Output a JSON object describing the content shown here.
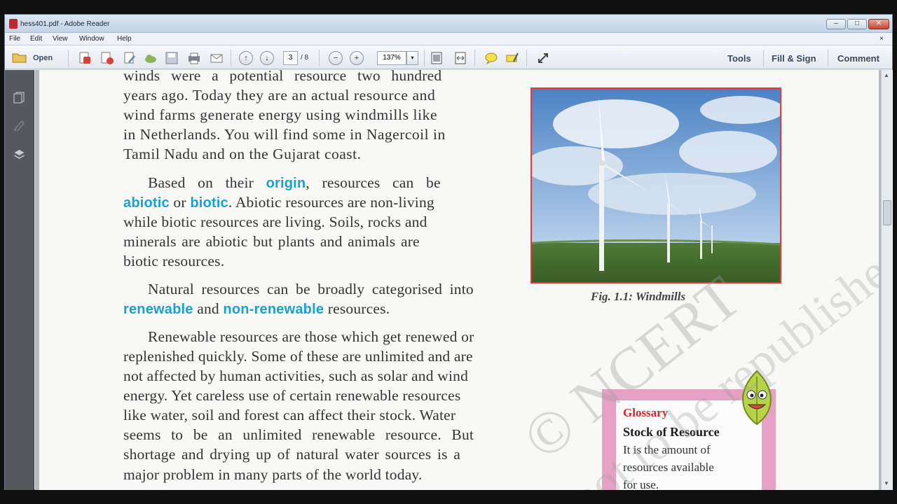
{
  "window": {
    "title": "hess401.pdf - Adobe Reader",
    "controls": {
      "minimize": "–",
      "maximize": "□",
      "close": "✕"
    }
  },
  "menu": {
    "items": [
      "File",
      "Edit",
      "View",
      "Window",
      "Help"
    ],
    "close_glyph": "×"
  },
  "toolbar": {
    "open_label": "Open",
    "page_current": "3",
    "page_total": "/ 8",
    "zoom": "137%",
    "zoom_dropdown_glyph": "▾",
    "zoom_out_glyph": "−",
    "zoom_in_glyph": "+",
    "prev_glyph": "↑",
    "next_glyph": "↓",
    "tools_label": "Tools",
    "fillsign_label": "Fill & Sign",
    "comment_label": "Comment"
  },
  "document": {
    "paragraph1": [
      "winds were a potential resource two hundred",
      "years ago. Today they are an actual resource and",
      "wind farms generate energy using windmills like",
      "in Netherlands. You will find some in Nagercoil in",
      "Tamil Nadu and on the Gujarat coast."
    ],
    "paragraph2": {
      "l1_a": "Based on their ",
      "l1_kw": "origin",
      "l1_b": ", resources can be",
      "l2_kw1": "abiotic",
      "l2_a": " or ",
      "l2_kw2": "biotic",
      "l2_b": ". Abiotic resources are non-living",
      "l3": "while biotic resources are living. Soils, rocks and",
      "l4": "minerals are abiotic but plants and animals are",
      "l5": "biotic resources."
    },
    "paragraph3": {
      "l1": "Natural resources can be broadly categorised into",
      "l2_kw1": "renewable",
      "l2_a": " and ",
      "l2_kw2": "non-renewable",
      "l2_b": " resources."
    },
    "paragraph4": [
      "Renewable resources are those which get renewed or",
      "replenished quickly. Some of these are unlimited and are",
      "not affected by human activities, such as solar and wind",
      "energy. Yet careless use of certain renewable resources",
      "like water, soil and forest can affect their stock. Water",
      "seems to be an unlimited renewable resource. But",
      "shortage and drying up of natural water sources is a",
      "major problem in many parts of the world today."
    ],
    "figure_caption": "Fig. 1.1: Windmills",
    "glossary": {
      "title": "Glossary",
      "heading": "Stock of Resource",
      "lines": [
        "It is the amount of",
        "resources available",
        "for use."
      ]
    },
    "watermark": [
      "© NCERT",
      "not to be republished"
    ]
  },
  "colors": {
    "keyword": "#17a3cd",
    "glossary_title": "#d02828",
    "figure_border": "#e63a3a",
    "glossary_frame": "#e6a1c4"
  },
  "icons": [
    "open-folder-icon",
    "create-pdf-icon",
    "edit-icon",
    "cloud-icon",
    "save-icon",
    "print-icon",
    "email-icon",
    "sticky-note-icon",
    "highlight-icon",
    "expand-icon",
    "fit-page-icon",
    "fit-width-icon",
    "pages-panel-icon",
    "signatures-panel-icon",
    "layers-panel-icon",
    "leaf-mascot-icon"
  ]
}
